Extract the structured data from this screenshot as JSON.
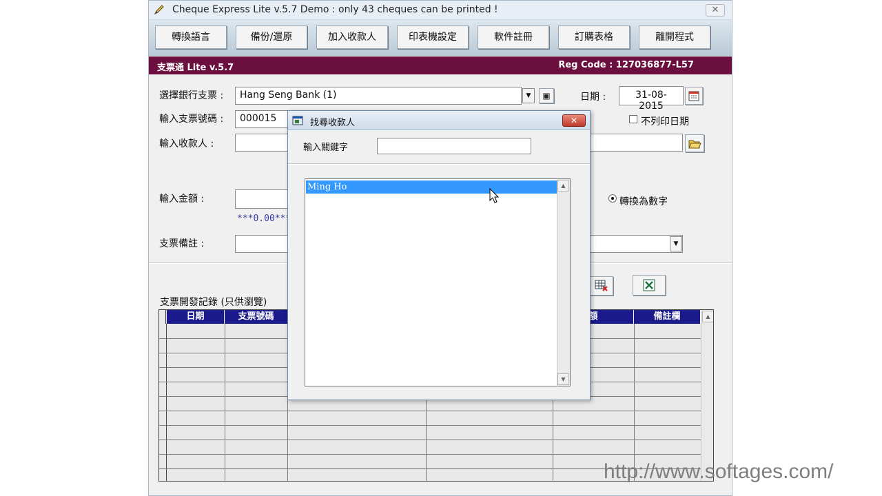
{
  "window": {
    "title": "Cheque Express Lite v.5.7 Demo : only 43 cheques can be printed !",
    "close_label": "✕"
  },
  "toolbar": {
    "buttons": [
      "轉換語言",
      "備份/還原",
      "加入收款人",
      "印表機設定",
      "軟件註冊",
      "訂購表格",
      "離開程式"
    ]
  },
  "banner": {
    "app_name": "支票通 Lite v.5.7",
    "reg_code": "Reg Code :  127036877-L57"
  },
  "form": {
    "bank_label": "選擇銀行支票 :",
    "bank_value": "Hang Seng Bank (1)",
    "date_label": "日期 :",
    "date_value": "31-08-2015",
    "cheque_no_label": "輸入支票號碼 :",
    "cheque_no_value": "000015",
    "no_print_date_label": "不列印日期",
    "payee_label": "輸入收款人 :",
    "amount_label": "輸入金額 :",
    "amount_words": "***0.00***",
    "convert_label": "轉換為數字",
    "remark_label": "支票備註 :"
  },
  "records": {
    "title": "支票開發記錄 (只供瀏覽)",
    "columns": [
      "日期",
      "支票號碼",
      "",
      "",
      "額",
      "備註欄"
    ]
  },
  "dialog": {
    "title": "找尋收款人",
    "keyword_label": "輸入關鍵字",
    "keyword_value": "",
    "results": [
      "Ming Ho"
    ]
  },
  "watermark": "http://www.softages.com/",
  "colors": {
    "banner": "#6b0f3e",
    "grid_header": "#1a1a8c",
    "selection": "#3399ff"
  }
}
